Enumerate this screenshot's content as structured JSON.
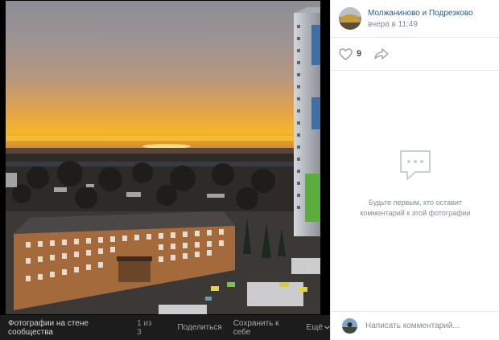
{
  "photo": {
    "description_icon": "sunset-photo"
  },
  "footer": {
    "caption": "Фотографии на стене сообщества",
    "counter": "1 из 3",
    "share_label": "Поделиться",
    "save_label": "Сохранить к себе",
    "more_label": "Ещё"
  },
  "post": {
    "author": "Молжаниново и Подрезково",
    "time": "вчера в 11:49",
    "likes": "9"
  },
  "comments": {
    "empty_line1": "Будьте первым, кто оставит",
    "empty_line2": "комментарий к этой фотографии",
    "placeholder": "Написать комментарий..."
  },
  "colors": {
    "link": "#2a5885",
    "muted": "#818c99"
  }
}
